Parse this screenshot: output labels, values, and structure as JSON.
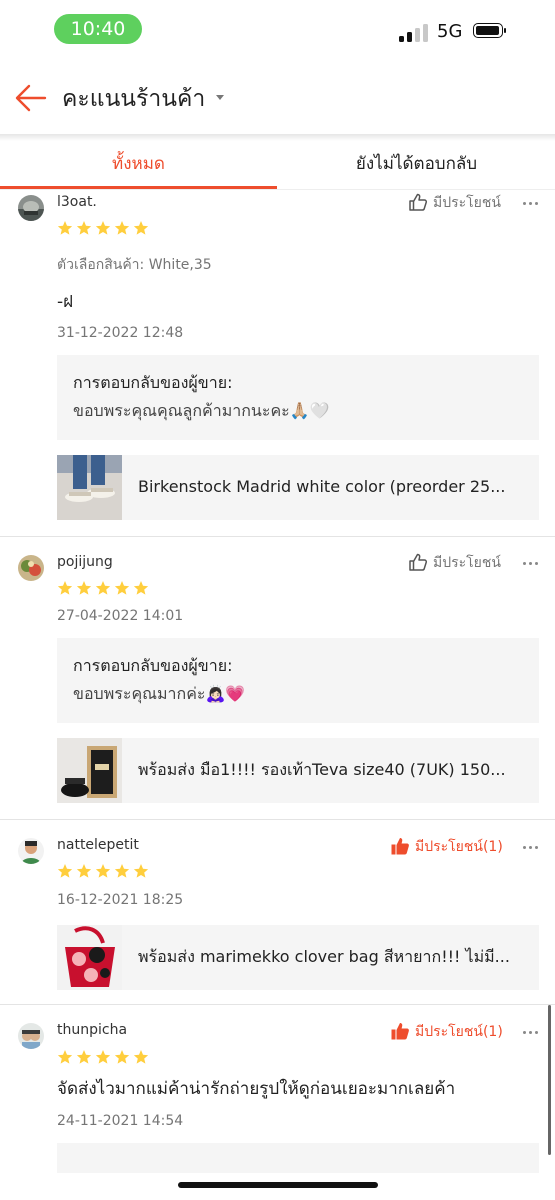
{
  "status_bar": {
    "time": "10:40",
    "network": "5G",
    "time_pill_color": "#5ed05e"
  },
  "header": {
    "title": "คะแนนร้านค้า",
    "back_icon": "arrow-left-icon",
    "accent_color": "#ee4d2d"
  },
  "tabs": [
    {
      "label": "ทั้งหมด",
      "selected": true
    },
    {
      "label": "ยังไม่ได้ตอบกลับ",
      "selected": false
    }
  ],
  "reviews": [
    {
      "username": "l3oat.",
      "rating": 5,
      "helpful_label": "มีประโยชน์",
      "helpful_active": false,
      "variant": "ตัวเลือกสินค้า: White,35",
      "comment": "-ฝ",
      "date": "31-12-2022 12:48",
      "seller_reply_title": "การตอบกลับของผู้ขาย:",
      "seller_reply_text": "ขอบพระคุณคุณลูกค้ามากนะคะ🙏🏼🤍",
      "product": "Birkenstock Madrid white color (preorder 25..."
    },
    {
      "username": "pojijung",
      "rating": 5,
      "helpful_label": "มีประโยชน์",
      "helpful_active": false,
      "date": "27-04-2022 14:01",
      "seller_reply_title": "การตอบกลับของผู้ขาย:",
      "seller_reply_text": "ขอบพระคุณมากค่ะ🙇🏻‍♀️💗",
      "product": "พร้อมส่ง มือ1!!!! รองเท้าTeva size40 (7UK) 150..."
    },
    {
      "username": "nattelepetit",
      "rating": 5,
      "helpful_label": "มีประโยชน์(1)",
      "helpful_active": true,
      "date": "16-12-2021 18:25",
      "product": "พร้อมส่ง marimekko clover bag สีหายาก!!! ไม่มี..."
    },
    {
      "username": "thunpicha",
      "rating": 5,
      "helpful_label": "มีประโยชน์(1)",
      "helpful_active": true,
      "comment": "จัดส่งไวมากแม่ค้าน่ารักถ่ายรูปให้ดูก่อนเยอะมากเลยค้า",
      "date": "24-11-2021 14:54"
    }
  ],
  "colors": {
    "star": "#ffce3d",
    "helpful_active": "#ee4d2d",
    "helpful_inactive": "#757575"
  }
}
